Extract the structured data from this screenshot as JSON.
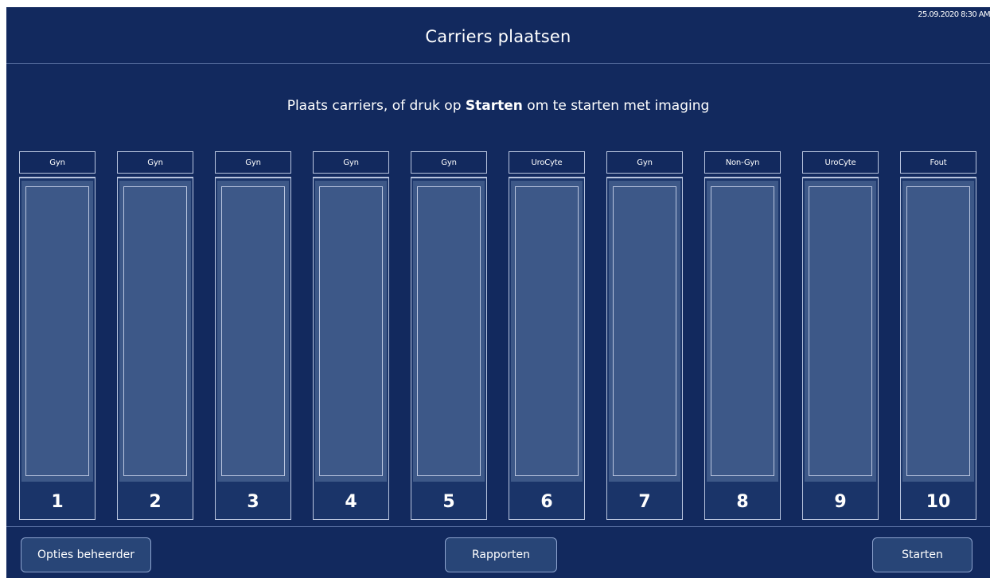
{
  "header": {
    "title": "Carriers plaatsen",
    "timestamp": "25.09.2020 8:30 AM"
  },
  "instruction": {
    "prefix": "Plaats carriers, of druk op ",
    "bold": "Starten",
    "suffix": " om te starten met imaging"
  },
  "carriers": [
    {
      "label": "Gyn",
      "number": "1"
    },
    {
      "label": "Gyn",
      "number": "2"
    },
    {
      "label": "Gyn",
      "number": "3"
    },
    {
      "label": "Gyn",
      "number": "4"
    },
    {
      "label": "Gyn",
      "number": "5"
    },
    {
      "label": "UroCyte",
      "number": "6"
    },
    {
      "label": "Gyn",
      "number": "7"
    },
    {
      "label": "Non-Gyn",
      "number": "8"
    },
    {
      "label": "UroCyte",
      "number": "9"
    },
    {
      "label": "Fout",
      "number": "10"
    }
  ],
  "footer": {
    "admin_label": "Opties beheerder",
    "reports_label": "Rapporten",
    "start_label": "Starten"
  },
  "colors": {
    "background": "#12295e",
    "carrier_fill": "#3d5888",
    "button_fill": "#284577",
    "border": "#b9c5df"
  }
}
